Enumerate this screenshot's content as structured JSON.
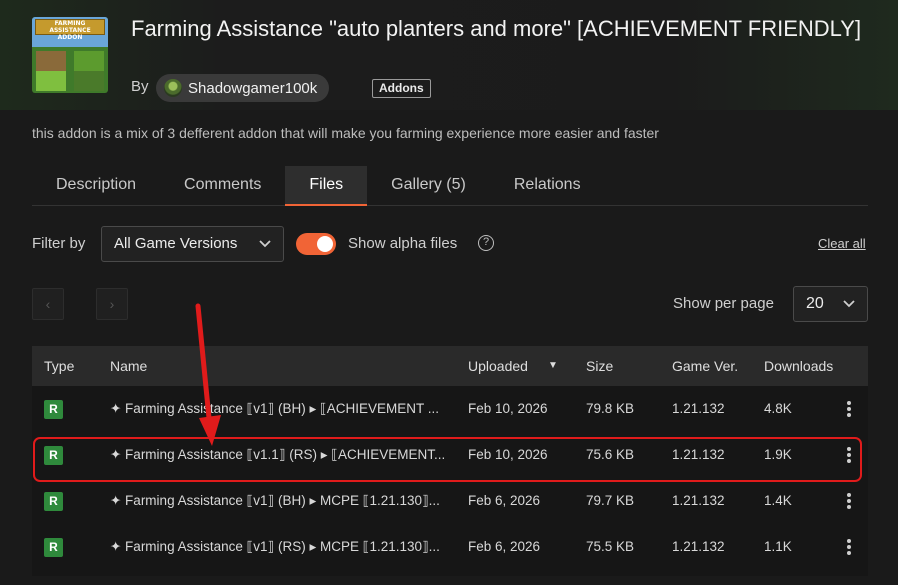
{
  "project": {
    "title": "Farming Assistance \"auto planters and more\" [ACHIEVEMENT FRIENDLY]",
    "by_label": "By",
    "author": "Shadowgamer100k",
    "category_tag": "Addons",
    "summary": "this addon is a mix of 3 defferent addon that will make you farming experience more easier and faster",
    "thumbnail_banner": "FARMING ASSISTANCE ADDON"
  },
  "tabs": [
    {
      "label": "Description",
      "active": false
    },
    {
      "label": "Comments",
      "active": false
    },
    {
      "label": "Files",
      "active": true
    },
    {
      "label": "Gallery (5)",
      "active": false
    },
    {
      "label": "Relations",
      "active": false
    }
  ],
  "filters": {
    "filter_by_label": "Filter by",
    "game_version_selected": "All Game Versions",
    "show_alpha_label": "Show alpha files",
    "show_alpha_enabled": true,
    "help_glyph": "?",
    "clear_all_label": "Clear all"
  },
  "pagination": {
    "prev_glyph": "‹",
    "next_glyph": "›",
    "show_per_page_label": "Show per page",
    "per_page_value": "20"
  },
  "table": {
    "headers": {
      "type": "Type",
      "name": "Name",
      "uploaded": "Uploaded",
      "size": "Size",
      "game_ver": "Game Ver.",
      "downloads": "Downloads"
    },
    "sort_indicator": "▼",
    "rows": [
      {
        "type": "R",
        "name": "✦ Farming Assistance ⟦v1⟧ (BH) ▸ ⟦ACHIEVEMENT ...",
        "uploaded": "Feb 10, 2026",
        "size": "79.8 KB",
        "game_ver": "1.21.132",
        "downloads": "4.8K"
      },
      {
        "type": "R",
        "name": "✦ Farming Assistance ⟦v1.1⟧ (RS) ▸ ⟦ACHIEVEMENT...",
        "uploaded": "Feb 10, 2026",
        "size": "75.6 KB",
        "game_ver": "1.21.132",
        "downloads": "1.9K"
      },
      {
        "type": "R",
        "name": "✦ Farming Assistance ⟦v1⟧ (BH) ▸ MCPE ⟦1.21.130⟧...",
        "uploaded": "Feb 6, 2026",
        "size": "79.7 KB",
        "game_ver": "1.21.132",
        "downloads": "1.4K"
      },
      {
        "type": "R",
        "name": "✦ Farming Assistance ⟦v1⟧ (RS) ▸ MCPE ⟦1.21.130⟧...",
        "uploaded": "Feb 6, 2026",
        "size": "75.5 KB",
        "game_ver": "1.21.132",
        "downloads": "1.1K"
      }
    ]
  },
  "colors": {
    "accent": "#f16436",
    "release_badge": "#2f8a3c",
    "highlight_annotation": "#e01b1b"
  },
  "annotations": {
    "highlighted_row_index": 1,
    "arrow": "red-arrow-pointing-down"
  }
}
